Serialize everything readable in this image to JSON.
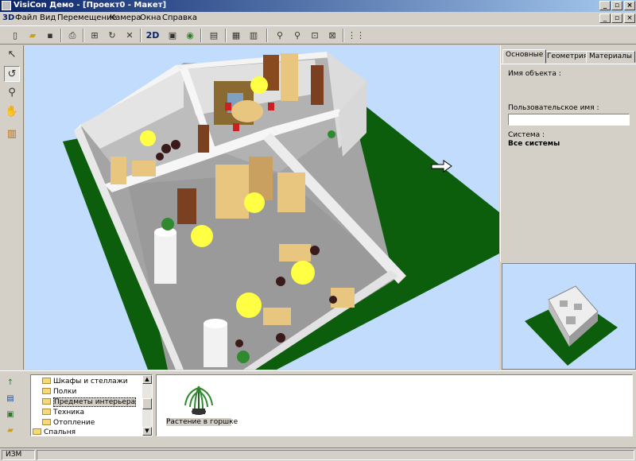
{
  "window": {
    "title": "VisiCon Демо - [Проект0 - Макет]"
  },
  "menu": {
    "logo": "3D",
    "items": [
      "Файл",
      "Вид",
      "Перемещение",
      "Камера",
      "Окна",
      "Справка"
    ]
  },
  "toolbar": {
    "view2d_label": "2D"
  },
  "properties": {
    "tabs": [
      "Основные",
      "Геометрия",
      "Материалы"
    ],
    "active_tab": "Основные",
    "object_name_label": "Имя объекта :",
    "object_name_value": "",
    "user_name_label": "Пользовательское имя :",
    "user_name_value": "",
    "system_label": "Система :",
    "system_value": "Все системы"
  },
  "catalog": {
    "tree_items": [
      "Шкафы и стеллажи",
      "Полки",
      "Предметы интерьера",
      "Техника",
      "Отопление",
      "Спальня"
    ],
    "selected": "Предметы интерьера",
    "gallery_items": [
      {
        "label": "Растение в горшке",
        "icon": "potted-plant-icon"
      }
    ]
  },
  "statusbar": {
    "mode": "ИЗМ"
  },
  "colors": {
    "title_start": "#0a246a",
    "title_end": "#a6caf0",
    "sky": "#c1dcfd",
    "ground": "#0c5e0c",
    "floor": "#a8a8a8",
    "wall": "#f0f0f0",
    "lamp": "#ffff44",
    "furniture": "#e8c680"
  }
}
